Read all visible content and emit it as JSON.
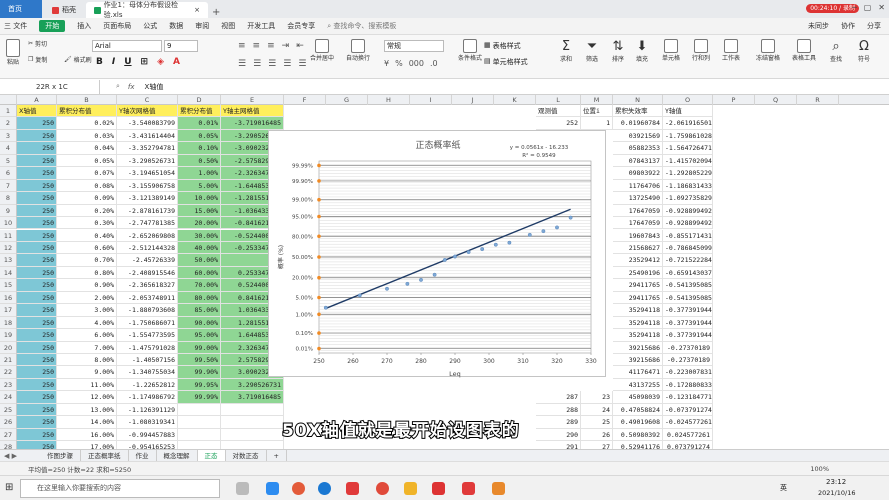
{
  "titlebar": {
    "home_label": "首页",
    "tab2_label": "稻壳",
    "doc_tab_label": "作业1：母体分布假设检验.xls",
    "time_chip": "00:24:10 / 录制"
  },
  "menubar": {
    "items": [
      "三 文件",
      "开始",
      "插入",
      "页面布局",
      "公式",
      "数据",
      "审阅",
      "视图",
      "开发工具",
      "会员专享"
    ],
    "search": "查找命令、搜索模板",
    "sync": "未同步",
    "collab": "协作",
    "share": "分享"
  },
  "ribbon": {
    "cut": "剪切",
    "copy": "复制",
    "format_painter": "格式刷",
    "paste": "粘贴",
    "font_name": "Arial",
    "font_size": "9",
    "merge": "合并居中",
    "wrap": "自动换行",
    "number_format": "常规",
    "cond_format": "条件格式",
    "cell_style": "单元格样式",
    "table_style": "表格样式",
    "sum": "求和",
    "filter": "筛选",
    "sort": "排序",
    "fill": "填充",
    "cell": "单元格",
    "row_col": "行和列",
    "worksheet": "工作表",
    "freeze": "冻结窗格",
    "table_tools": "表格工具",
    "find": "查找",
    "symbol": "符号"
  },
  "formula": {
    "namebox": "22R x 1C",
    "fx": "fx",
    "content": "X轴值"
  },
  "columns": [
    "A",
    "B",
    "C",
    "D",
    "E",
    "F",
    "G",
    "H",
    "I",
    "J",
    "K",
    "L",
    "M",
    "N",
    "O",
    "P",
    "Q",
    "R"
  ],
  "headers": {
    "A": "X轴值",
    "B": "累积分布值",
    "C": "Y轴次网格值",
    "D": "累积分布值",
    "E": "Y轴主网格值",
    "L": "观测值",
    "M": "位置i",
    "N": "累积失效率",
    "O": "Y轴值"
  },
  "rows": [
    {
      "n": "2",
      "A": "250",
      "B": "0.02%",
      "C": "-3.540083799",
      "D": "0.01%",
      "E": "-3.719016485",
      "L": "252",
      "M": "1",
      "N": "0.01960784",
      "O": "-2.061916501"
    },
    {
      "n": "3",
      "A": "250",
      "B": "0.03%",
      "C": "-3.431614404",
      "D": "0.05%",
      "E": "-3.290526731",
      "L": "",
      "M": "",
      "N": "03921569",
      "O": "-1.759861028"
    },
    {
      "n": "4",
      "A": "250",
      "B": "0.04%",
      "C": "-3.352794781",
      "D": "0.10%",
      "E": "-3.090232306",
      "L": "",
      "M": "",
      "N": "05882353",
      "O": "-1.564726471"
    },
    {
      "n": "5",
      "A": "250",
      "B": "0.05%",
      "C": "-3.290526731",
      "D": "0.50%",
      "E": "-2.575829304",
      "L": "",
      "M": "",
      "N": "07843137",
      "O": "-1.415702094"
    },
    {
      "n": "6",
      "A": "250",
      "B": "0.07%",
      "C": "-3.194651054",
      "D": "1.00%",
      "E": "-2.326347874",
      "L": "",
      "M": "",
      "N": "09803922",
      "O": "-1.292805229"
    },
    {
      "n": "7",
      "A": "250",
      "B": "0.08%",
      "C": "-3.155906758",
      "D": "5.00%",
      "E": "-1.644853627",
      "L": "",
      "M": "",
      "N": "11764706",
      "O": "-1.186831433"
    },
    {
      "n": "8",
      "A": "250",
      "B": "0.09%",
      "C": "-3.121389149",
      "D": "10.00%",
      "E": "-1.281551566",
      "L": "",
      "M": "",
      "N": "13725490",
      "O": "-1.092735829"
    },
    {
      "n": "9",
      "A": "250",
      "B": "0.20%",
      "C": "-2.878161739",
      "D": "15.00%",
      "E": "-1.036433389",
      "L": "",
      "M": "",
      "N": "17647059",
      "O": "-0.928899492"
    },
    {
      "n": "10",
      "A": "250",
      "B": "0.30%",
      "C": "-2.747781385",
      "D": "20.00%",
      "E": "-0.841621234",
      "L": "",
      "M": "",
      "N": "17647059",
      "O": "-0.928899492"
    },
    {
      "n": "11",
      "A": "250",
      "B": "0.40%",
      "C": "-2.652069808",
      "D": "30.00%",
      "E": "-0.524400513",
      "L": "",
      "M": "",
      "N": "19607843",
      "O": "-0.855171431"
    },
    {
      "n": "12",
      "A": "250",
      "B": "0.60%",
      "C": "-2.512144328",
      "D": "40.00%",
      "E": "-0.253347103",
      "L": "",
      "M": "",
      "N": "21568627",
      "O": "-0.786845099"
    },
    {
      "n": "13",
      "A": "250",
      "B": "0.70%",
      "C": "-2.45726339",
      "D": "50.00%",
      "E": "0",
      "L": "",
      "M": "",
      "N": "23529412",
      "O": "-0.721522284"
    },
    {
      "n": "14",
      "A": "250",
      "B": "0.80%",
      "C": "-2.408915546",
      "D": "60.00%",
      "E": "0.253347103",
      "L": "",
      "M": "",
      "N": "25490196",
      "O": "-0.659143037"
    },
    {
      "n": "15",
      "A": "250",
      "B": "0.90%",
      "C": "-2.365618327",
      "D": "70.00%",
      "E": "0.524400513",
      "L": "",
      "M": "",
      "N": "29411765",
      "O": "-0.541395085"
    },
    {
      "n": "16",
      "A": "250",
      "B": "2.00%",
      "C": "-2.053748911",
      "D": "80.00%",
      "E": "0.841621234",
      "L": "",
      "M": "",
      "N": "29411765",
      "O": "-0.541395085"
    },
    {
      "n": "17",
      "A": "250",
      "B": "3.00%",
      "C": "-1.880793608",
      "D": "85.00%",
      "E": "1.036433389",
      "L": "",
      "M": "",
      "N": "35294118",
      "O": "-0.377391944"
    },
    {
      "n": "18",
      "A": "250",
      "B": "4.00%",
      "C": "-1.750686071",
      "D": "90.00%",
      "E": "1.281551566",
      "L": "",
      "M": "",
      "N": "35294118",
      "O": "-0.377391944"
    },
    {
      "n": "19",
      "A": "250",
      "B": "6.00%",
      "C": "-1.554773595",
      "D": "95.00%",
      "E": "1.644853627",
      "L": "",
      "M": "",
      "N": "35294118",
      "O": "-0.377391944"
    },
    {
      "n": "20",
      "A": "250",
      "B": "7.00%",
      "C": "-1.475791028",
      "D": "99.00%",
      "E": "2.326347874",
      "L": "",
      "M": "",
      "N": "39215686",
      "O": "-0.27370189"
    },
    {
      "n": "21",
      "A": "250",
      "B": "8.00%",
      "C": "-1.40507156",
      "D": "99.50%",
      "E": "2.575829304",
      "L": "",
      "M": "",
      "N": "39215686",
      "O": "-0.27370189"
    },
    {
      "n": "22",
      "A": "250",
      "B": "9.00%",
      "C": "-1.340755034",
      "D": "99.90%",
      "E": "3.090232306",
      "L": "",
      "M": "",
      "N": "41176471",
      "O": "-0.223007831"
    },
    {
      "n": "23",
      "A": "250",
      "B": "11.00%",
      "C": "-1.22652812",
      "D": "99.95%",
      "E": "3.290526731",
      "L": "",
      "M": "",
      "N": "43137255",
      "O": "-0.172880833"
    },
    {
      "n": "24",
      "A": "250",
      "B": "12.00%",
      "C": "-1.174986792",
      "D": "99.99%",
      "E": "3.719016485",
      "L": "287",
      "M": "23",
      "N": "45098039",
      "O": "-0.123184771"
    },
    {
      "n": "25",
      "A": "250",
      "B": "13.00%",
      "C": "-1.126391129",
      "D": "",
      "E": "",
      "L": "288",
      "M": "24",
      "N": "0.47058824",
      "O": "-0.073791274"
    },
    {
      "n": "26",
      "A": "250",
      "B": "14.00%",
      "C": "-1.080319341",
      "D": "",
      "E": "",
      "L": "289",
      "M": "25",
      "N": "0.49019608",
      "O": "-0.024577261"
    },
    {
      "n": "27",
      "A": "250",
      "B": "16.00%",
      "C": "-0.994457883",
      "D": "",
      "E": "",
      "L": "290",
      "M": "26",
      "N": "0.50980392",
      "O": "0.024577261"
    },
    {
      "n": "28",
      "A": "250",
      "B": "17.00%",
      "C": "-0.954165253",
      "D": "",
      "E": "",
      "L": "291",
      "M": "27",
      "N": "0.52941176",
      "O": "0.073791274"
    }
  ],
  "chart_data": {
    "type": "scatter",
    "title": "正态概率纸",
    "xlabel": "Leq",
    "ylabel": "概率 (%)",
    "xlim": [
      250,
      330
    ],
    "x_ticks": [
      "250",
      "260",
      "270",
      "280",
      "290",
      "300",
      "310",
      "320",
      "330"
    ],
    "y_ticks": [
      "0.01%",
      "0.10%",
      "1.00%",
      "5.00%",
      "20.00%",
      "50.00%",
      "80.00%",
      "95.00%",
      "99.00%",
      "99.90%",
      "99.99%"
    ],
    "equation": "y = 0.0561x - 16.233",
    "r2": "R² = 0.9549",
    "series": [
      {
        "values": [
          [
            252,
            -2.06
          ],
          [
            262,
            -1.56
          ],
          [
            270,
            -1.29
          ],
          [
            276,
            -1.09
          ],
          [
            280,
            -0.93
          ],
          [
            284,
            -0.72
          ],
          [
            287,
            -0.12
          ],
          [
            290,
            0.02
          ],
          [
            294,
            0.2
          ],
          [
            298,
            0.32
          ],
          [
            302,
            0.5
          ],
          [
            306,
            0.58
          ],
          [
            312,
            0.9
          ],
          [
            316,
            1.05
          ],
          [
            320,
            1.2
          ],
          [
            324,
            1.6
          ]
        ]
      }
    ],
    "trendline": [
      [
        252,
        -2.09
      ],
      [
        324,
        1.94
      ]
    ],
    "grid": true
  },
  "sheettabs": [
    "作图步骤",
    "正态概率纸",
    "作业",
    "概念理解",
    "正态",
    "对数正态"
  ],
  "active_sheet": "正态",
  "statusbar": {
    "info": "平均值=250  计数=22  求和=5250",
    "zoom": "100%"
  },
  "taskbar": {
    "search_placeholder": "在这里输入你要搜索的内容",
    "time": "23:12",
    "date": "2021/10/16",
    "lang": "英"
  },
  "subtitle": "50X轴值就是最开始设图表的"
}
